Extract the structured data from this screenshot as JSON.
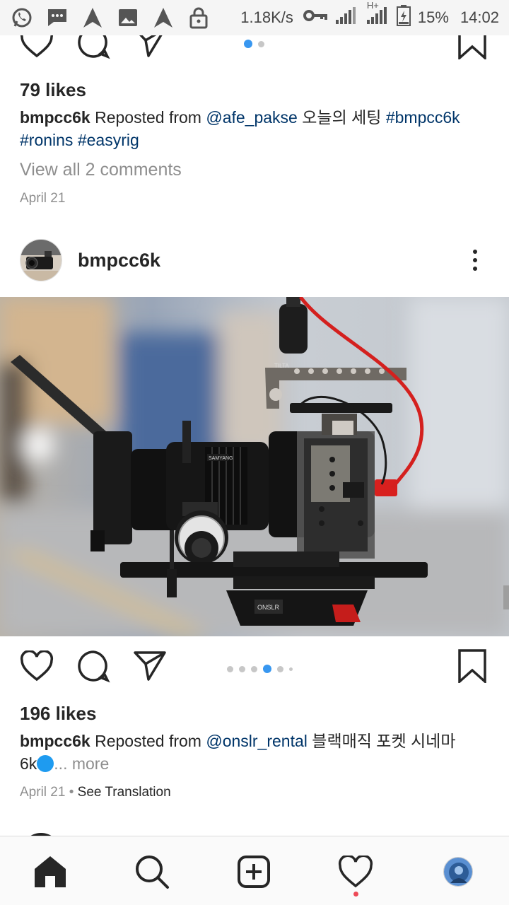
{
  "status_bar": {
    "speed": "1.18K/s",
    "network_label": "H+",
    "battery": "15%",
    "time": "14:02",
    "icons": [
      "whatsapp-icon",
      "message-icon",
      "navigation-icon",
      "image-icon",
      "navigation-icon",
      "lock-icon",
      "key-icon",
      "signal-icon",
      "signal-icon",
      "battery-icon"
    ]
  },
  "post1": {
    "likes": "79 likes",
    "user": "bmpcc6k",
    "caption_prefix": " Reposted from ",
    "mention": "@afe_pakse",
    "caption_text": " 오늘의 세팅 ",
    "tag1": "#bmpcc6k",
    "tag2": "#ronins",
    "tag3": "#easyrig",
    "comments": "View all 2 comments",
    "date": "April 21",
    "carousel_count": 2,
    "carousel_active": 1
  },
  "post2": {
    "username": "bmpcc6k",
    "likes": "196 likes",
    "user": "bmpcc6k",
    "caption_prefix": " Reposted from ",
    "mention": "@onslr_rental",
    "caption_text": " 블랙매직 포켓 시네마",
    "caption_line2": "6k",
    "more": "... more",
    "date": "April 21",
    "date_sep": " • ",
    "see_translation": "See Translation",
    "carousel_count": 6,
    "carousel_active": 4,
    "photo_labels": {
      "brand_top": "TILTA",
      "brand_lens": "SAMYANG",
      "brand_mount": "ONSLR"
    }
  },
  "colors": {
    "accent": "#3897f0",
    "link": "#003569",
    "muted": "#8e8e8e",
    "text": "#262626",
    "notification": "#ed4956"
  },
  "bottom_nav": [
    "home-icon",
    "search-icon",
    "new-post-icon",
    "activity-icon",
    "profile-avatar"
  ]
}
